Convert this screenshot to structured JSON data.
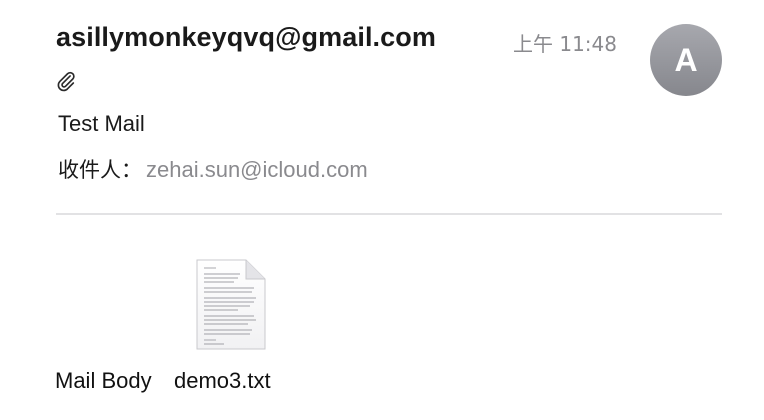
{
  "message": {
    "sender": "asillymonkeyqvq@gmail.com",
    "time": "上午 11:48",
    "avatar_initial": "A",
    "subject": "Test Mail",
    "recipient_label": "收件人：",
    "recipient": "zehai.sun@icloud.com",
    "has_attachment_icon": "paperclip-icon"
  },
  "attachments": {
    "body_label": "Mail Body",
    "file_name": "demo3.txt",
    "file_icon": "text-document-icon"
  },
  "colors": {
    "avatar": "#97989e",
    "secondary_text": "#8a8a8e",
    "divider": "#e2e2e4"
  }
}
